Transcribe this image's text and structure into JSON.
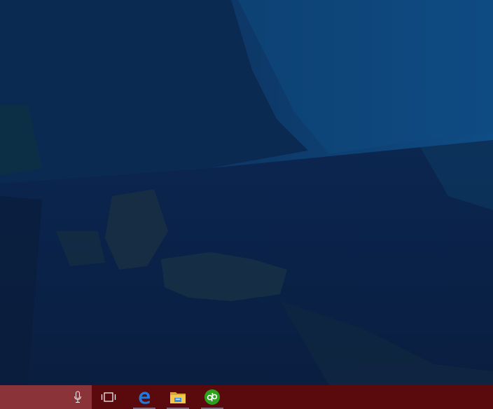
{
  "desktop": {
    "colors": {
      "base": "#0b2246",
      "sky": "#0c3a66",
      "sky_bright": "#0f4b80",
      "mountain": "#0f2f57",
      "shadow": "#0a1b3a",
      "olive": "#1d2f3a"
    }
  },
  "taskbar": {
    "colors": {
      "bar": "#5a0a0c",
      "search": "#8a3338"
    },
    "search": {
      "icon": "microphone-icon"
    },
    "buttons": [
      {
        "id": "task-view",
        "icon": "task-view-icon"
      },
      {
        "id": "edge",
        "icon": "edge-browser-icon",
        "accent": "#1f7ae0"
      },
      {
        "id": "file-explorer",
        "icon": "folder-icon",
        "accent": "#f3c84b"
      },
      {
        "id": "quickbooks",
        "icon": "quickbooks-icon",
        "accent": "#2ca01c"
      }
    ]
  }
}
